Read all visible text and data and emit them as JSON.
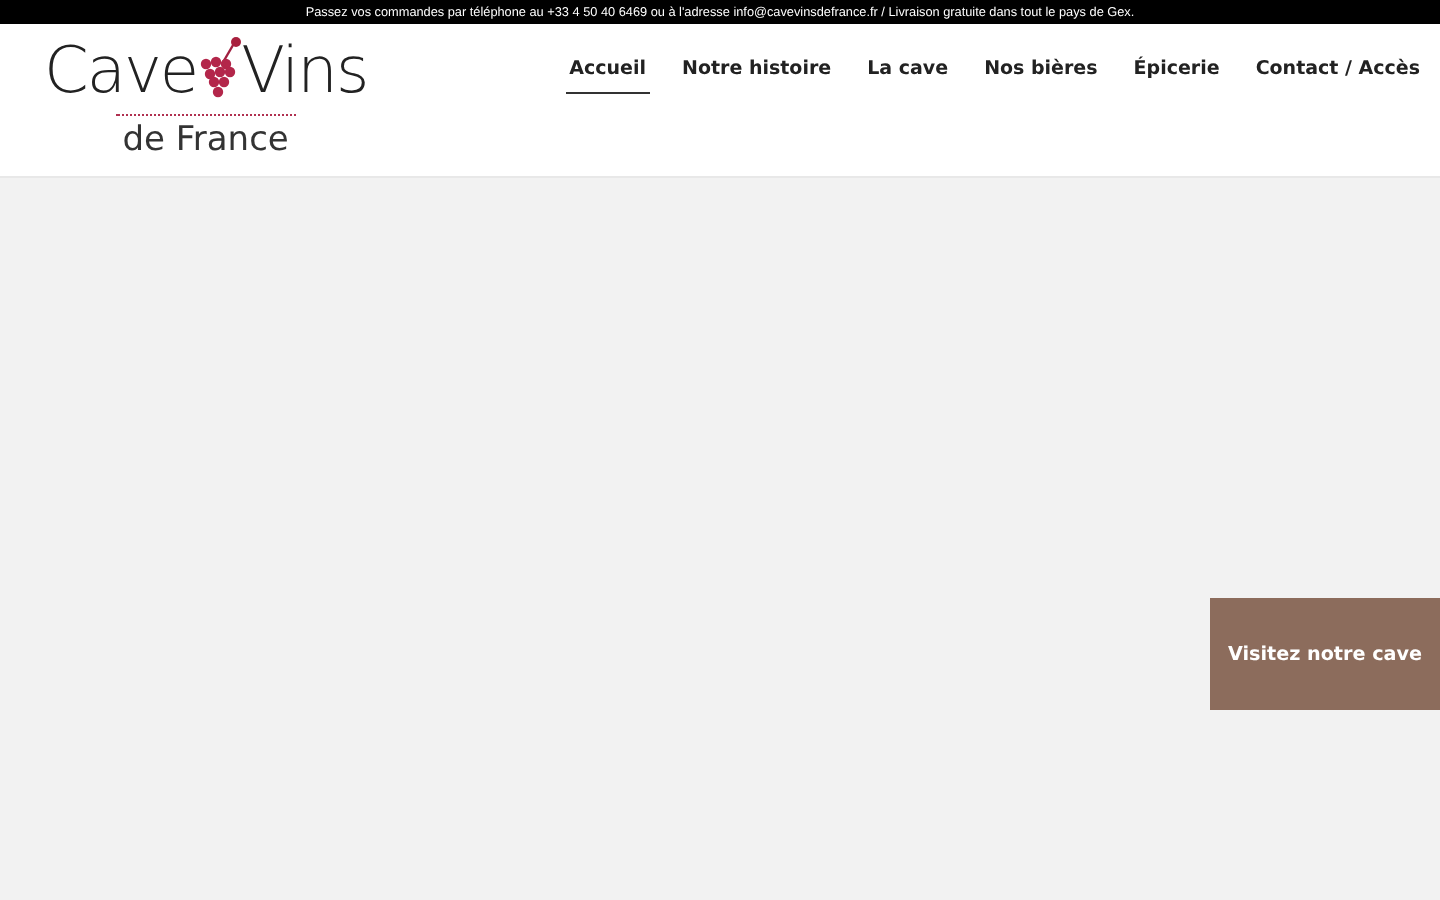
{
  "top_bar": {
    "text": "Passez vos commandes par téléphone au +33 4 50 40 6469 ou à l'adresse info@cavevinsdefrance.fr / Livraison gratuite dans tout le pays de Gex."
  },
  "logo": {
    "word_1": "Cave",
    "word_2": "Vins",
    "subtitle": "de France"
  },
  "nav": [
    {
      "label": "Accueil",
      "selected": true
    },
    {
      "label": "Notre histoire",
      "selected": false
    },
    {
      "label": "La cave",
      "selected": false
    },
    {
      "label": "Nos bières",
      "selected": false
    },
    {
      "label": "Épicerie",
      "selected": false
    },
    {
      "label": "Contact / Accès",
      "selected": false
    }
  ],
  "cta": {
    "label": "Visitez notre cave"
  }
}
